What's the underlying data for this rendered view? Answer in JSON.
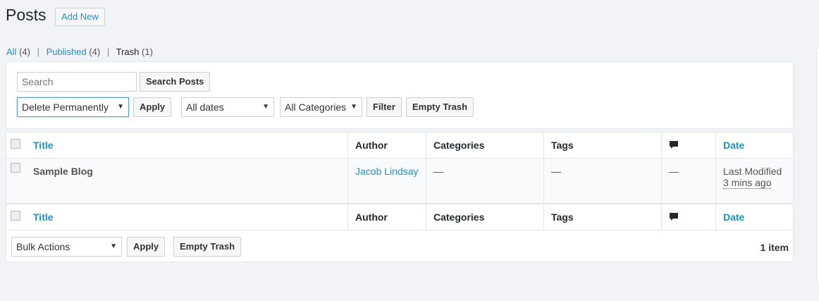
{
  "header": {
    "title": "Posts",
    "add_new_label": "Add New"
  },
  "filters": {
    "all_label": "All",
    "all_count": "(4)",
    "published_label": "Published",
    "published_count": "(4)",
    "trash_label": "Trash",
    "trash_count": "(1)",
    "separator": "|"
  },
  "toolbar_top": {
    "search_placeholder": "Search",
    "search_button": "Search Posts",
    "bulk_action_selected": "Delete Permanently",
    "apply_label": "Apply",
    "date_filter_selected": "All dates",
    "category_filter_selected": "All Categories",
    "filter_label": "Filter",
    "empty_trash_label": "Empty Trash"
  },
  "table": {
    "columns": {
      "title": "Title",
      "author": "Author",
      "categories": "Categories",
      "tags": "Tags",
      "comments_icon": "comment-icon",
      "date": "Date"
    },
    "rows": [
      {
        "title": "Sample Blog",
        "author": "Jacob Lindsay",
        "categories": "—",
        "tags": "—",
        "comments": "—",
        "date_status": "Last Modified",
        "date_value": "3 mins ago"
      }
    ]
  },
  "toolbar_bottom": {
    "bulk_action_selected": "Bulk Actions",
    "apply_label": "Apply",
    "empty_trash_label": "Empty Trash",
    "item_count": "1 item"
  },
  "colors": {
    "link": "#1b93c9",
    "background": "#f1f3f6",
    "panel": "#ffffff",
    "border": "#e3e6ea"
  }
}
